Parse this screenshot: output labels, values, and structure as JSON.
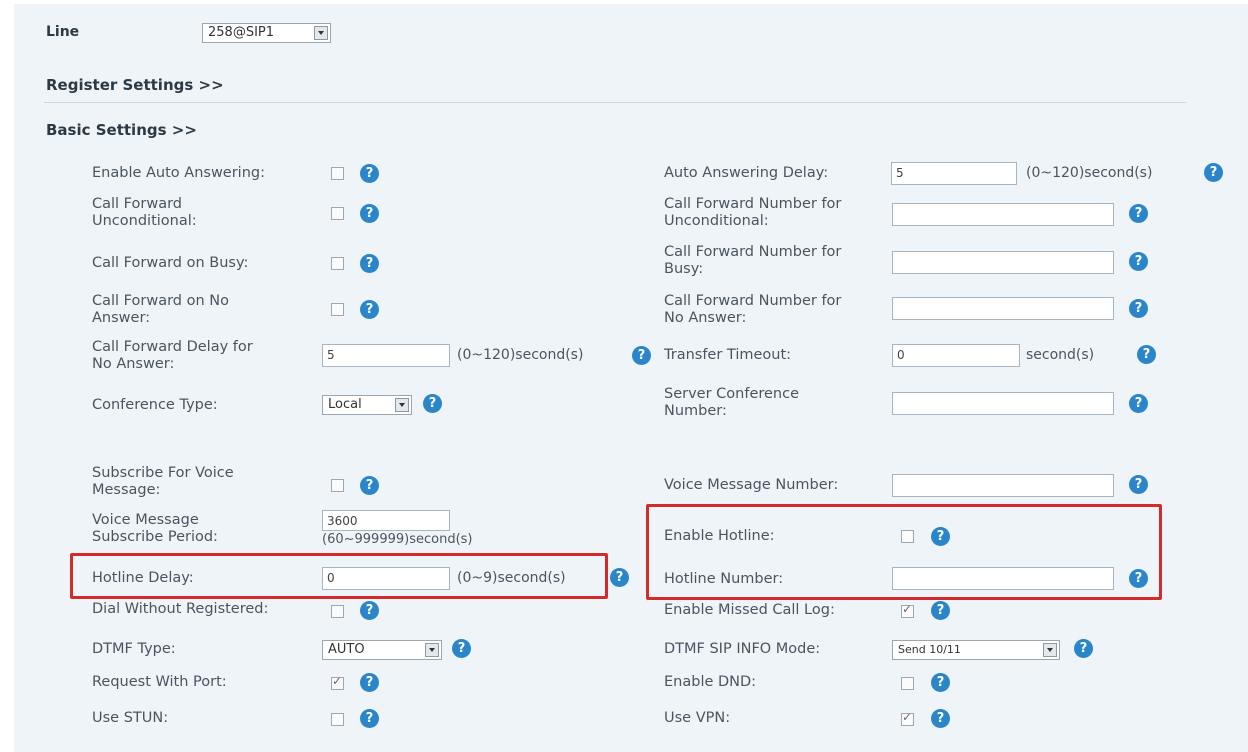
{
  "line": {
    "label": "Line",
    "value": "258@SIP1"
  },
  "sections": {
    "register": "Register Settings >>",
    "basic": "Basic Settings >>"
  },
  "help_glyph": "?",
  "left": {
    "auto_answer": "Enable Auto Answering:",
    "cf_uncond": "Call Forward\nUnconditional:",
    "cf_busy": "Call Forward on Busy:",
    "cf_noans": "Call Forward on No\nAnswer:",
    "cf_delay": "Call Forward Delay for\nNo Answer:",
    "cf_delay_value": "5",
    "cf_delay_unit": "(0~120)second(s)",
    "conf_type": "Conference Type:",
    "conf_type_value": "Local",
    "subscribe_vm": "Subscribe For Voice\nMessage:",
    "vm_period": "Voice Message\nSubscribe Period:",
    "vm_period_value": "3600",
    "vm_period_unit": "(60~999999)second(s)",
    "hotline_delay": "Hotline Delay:",
    "hotline_delay_value": "0",
    "hotline_delay_unit": "(0~9)second(s)",
    "dial_unreg": "Dial Without Registered:",
    "dtmf_type": "DTMF Type:",
    "dtmf_type_value": "AUTO",
    "req_port": "Request With Port:",
    "use_stun": "Use STUN:"
  },
  "right": {
    "auto_delay": "Auto Answering Delay:",
    "auto_delay_value": "5",
    "auto_delay_unit": "(0~120)second(s)",
    "cfn_uncond": "Call Forward Number for\nUnconditional:",
    "cfn_busy": "Call Forward Number for\nBusy:",
    "cfn_noans": "Call Forward Number for\nNo Answer:",
    "transfer_timeout": "Transfer Timeout:",
    "transfer_timeout_value": "0",
    "transfer_timeout_unit": "second(s)",
    "server_conf": "Server Conference\nNumber:",
    "vm_number": "Voice Message Number:",
    "enable_hotline": "Enable Hotline:",
    "hotline_number": "Hotline Number:",
    "missed_log": "Enable Missed Call Log:",
    "dtmf_sip": "DTMF SIP INFO Mode:",
    "dtmf_sip_value": "Send 10/11",
    "enable_dnd": "Enable DND:",
    "use_vpn": "Use VPN:"
  },
  "checkboxes": {
    "auto_answer": false,
    "cf_uncond": false,
    "cf_busy": false,
    "cf_noans": false,
    "subscribe_vm": false,
    "dial_unreg": false,
    "req_port": true,
    "use_stun": false,
    "enable_hotline": false,
    "missed_log": true,
    "enable_dnd": false,
    "use_vpn": true
  },
  "colors": {
    "highlight": "#d32b2b",
    "help": "#2a86c8",
    "background": "#eef4f8"
  }
}
